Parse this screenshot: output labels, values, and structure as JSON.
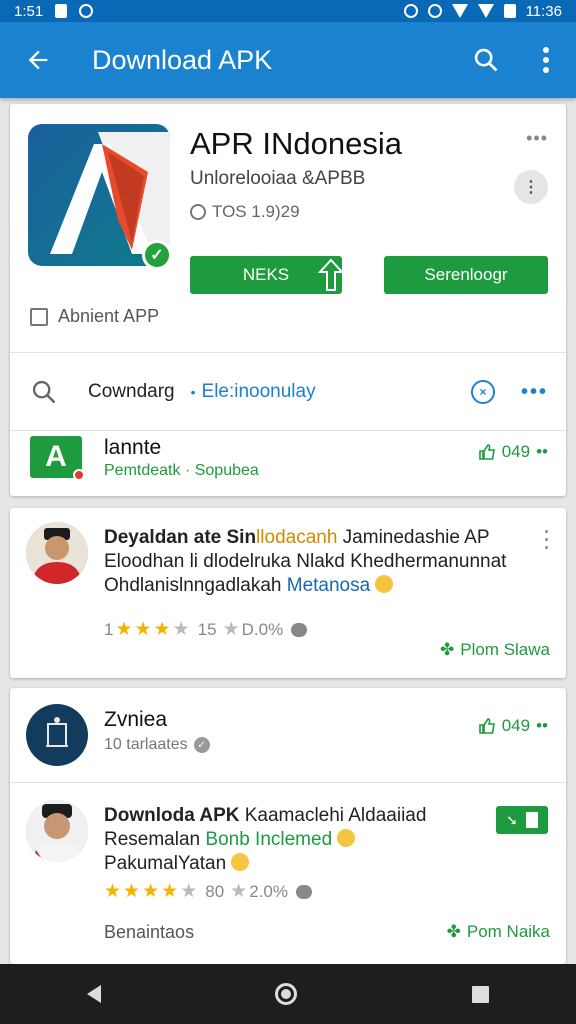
{
  "status_bar": {
    "time": "1:51",
    "right_time": "11:36",
    "icons": [
      "shield-icon",
      "lock-icon",
      "sync-icon",
      "alarm-icon",
      "wifi-icon",
      "signal-icon",
      "battery-icon"
    ]
  },
  "app_bar": {
    "title": "Download APK",
    "icons": [
      "back-arrow-icon",
      "search-icon",
      "more-vert-icon"
    ]
  },
  "app_card": {
    "name": "APR INdonesia",
    "developer": "Unlorelooiaa &APBB",
    "size": "TOS 1.9)29",
    "primary_button": "NEKS",
    "secondary_button": "Serenloogr",
    "ambient_label": "Abnient APP",
    "search_query": "Cowndarg",
    "filter_label": "Ele:inoonulay",
    "result": {
      "title": "lannte",
      "publisher": "Pemtdeatk",
      "category": "Sopubea",
      "count": "049"
    }
  },
  "review_1": {
    "line1_bold": "Deyaldan ate Sin",
    "line1_orange": "llodacanh",
    "line1_rest": " Jaminedashie AP",
    "line2": "Eloodhan li dlodelruka Nlakd Khedhermanunnat",
    "line3_text": "Ohdlanislnngadlakah ",
    "line3_blue": "Metanosa",
    "rating_text": "1",
    "rating_count": "15",
    "rating_value": "D.0%",
    "stars": 3.5,
    "action_label": "Plom Slawa"
  },
  "review_2": {
    "name": "Zvniea",
    "sub": "10 tarlaates",
    "count": "049",
    "line1_bold": "Downloda APK",
    "line1_rest": " Kaamaclehi Aldaaiiad",
    "line2_text": "Resemalan ",
    "line2_green": "Bonb Inclemed",
    "line3": "PakumalYatan",
    "rating_count": "80",
    "rating_value": "2.0%",
    "stars": 4.5,
    "footer_left": "Benaintaos",
    "action_label": "Pom Naika"
  },
  "colors": {
    "appbar": "#1a82cf",
    "status": "#0a69b7",
    "green": "#1e9b3e",
    "blue": "#1a82cf",
    "star": "#f3b400"
  }
}
